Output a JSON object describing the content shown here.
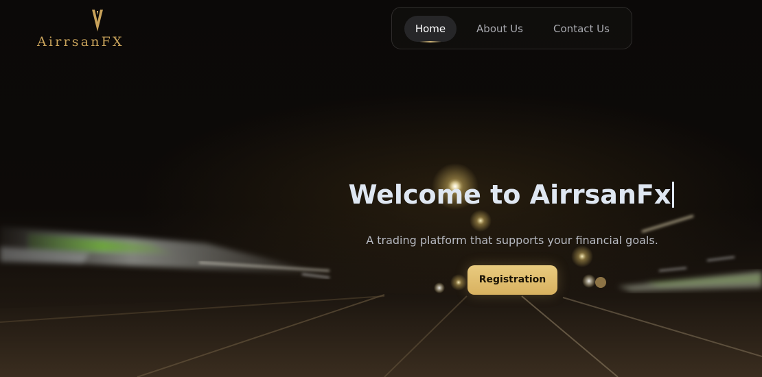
{
  "brand": {
    "logo_text": "AirrsanFX",
    "logo_color": "#c8a25a"
  },
  "nav": {
    "items": [
      {
        "label": "Home",
        "active": true
      },
      {
        "label": "About Us",
        "active": false
      },
      {
        "label": "Contact Us",
        "active": false
      }
    ]
  },
  "hero": {
    "title": "Welcome to AirrsanFx",
    "subtitle": "A trading platform that supports your financial goals.",
    "cta_label": "Registration",
    "cta_color": "#e2c070"
  },
  "background": {
    "scene": "night-highway-motion-blur",
    "colors": {
      "sky": "#0b0908",
      "road": "#2a2016",
      "lights": "#fff2b0"
    }
  },
  "icons": {
    "logo_mark": "v-emblem-icon",
    "text_cursor": "text-cursor-icon"
  }
}
